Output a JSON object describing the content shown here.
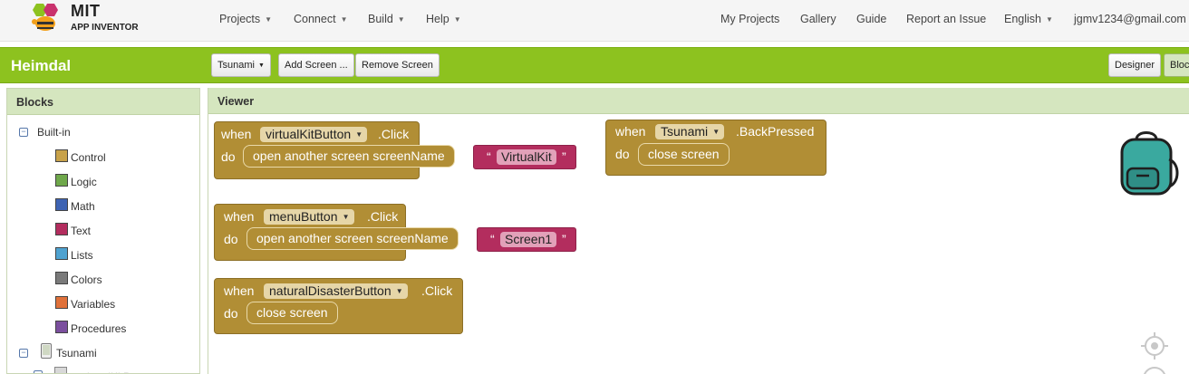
{
  "topnav": {
    "logo_mit": "MIT",
    "logo_sub": "APP INVENTOR",
    "menus": [
      {
        "label": "Projects"
      },
      {
        "label": "Connect"
      },
      {
        "label": "Build"
      },
      {
        "label": "Help"
      }
    ],
    "links": {
      "my_projects": "My Projects",
      "gallery": "Gallery",
      "guide": "Guide",
      "report": "Report an Issue",
      "language": "English",
      "user": "jgmv1234@gmail.com"
    }
  },
  "projectbar": {
    "name": "Heimdal",
    "screen_select": "Tsunami",
    "add_screen": "Add Screen ...",
    "remove_screen": "Remove Screen",
    "designer": "Designer",
    "blocks": "Bloc"
  },
  "blocks_panel": {
    "title": "Blocks",
    "builtin": "Built-in",
    "categories": [
      {
        "label": "Control",
        "color": "#c8a24a"
      },
      {
        "label": "Logic",
        "color": "#6fa84b"
      },
      {
        "label": "Math",
        "color": "#3e63b3"
      },
      {
        "label": "Text",
        "color": "#b32d5e"
      },
      {
        "label": "Lists",
        "color": "#4fa2d0"
      },
      {
        "label": "Colors",
        "color": "#7a7a7a"
      },
      {
        "label": "Variables",
        "color": "#e0713a"
      },
      {
        "label": "Procedures",
        "color": "#7b4f9e"
      }
    ],
    "screen": "Tsunami",
    "partial_item": "virtualKitButton"
  },
  "viewer": {
    "title": "Viewer",
    "blocks": [
      {
        "when": "when",
        "component": "virtualKitButton",
        "event": ".Click",
        "do": "do",
        "statement": "open another screen  screenName",
        "text_value": "VirtualKit"
      },
      {
        "when": "when",
        "component": "Tsunami",
        "event": ".BackPressed",
        "do": "do",
        "statement": "close screen"
      },
      {
        "when": "when",
        "component": "menuButton",
        "event": ".Click",
        "do": "do",
        "statement": "open another screen  screenName",
        "text_value": "Screen1"
      },
      {
        "when": "when",
        "component": "naturalDisasterButton",
        "event": ".Click",
        "do": "do",
        "statement": "close screen"
      }
    ],
    "quote_open": "“",
    "quote_close": "”"
  },
  "icons": {
    "backpack": "backpack-icon",
    "recenter": "crosshair-icon"
  }
}
